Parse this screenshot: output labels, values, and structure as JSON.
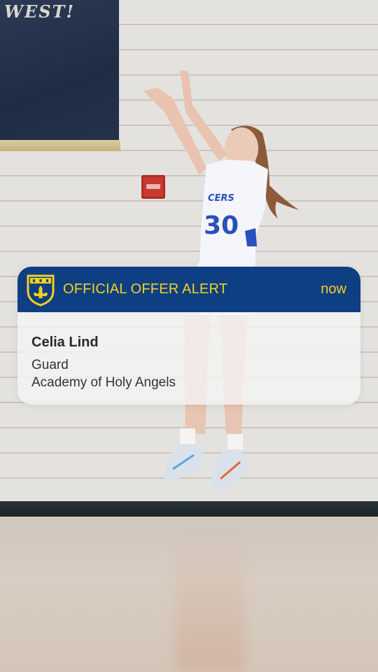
{
  "background": {
    "banner_text": "WEST!",
    "jersey_text": "CERS",
    "jersey_number": "30"
  },
  "notification": {
    "title": "OFFICIAL OFFER ALERT",
    "time": "now",
    "athlete_name": "Celia Lind",
    "position": "Guard",
    "school": "Academy of Holy Angels",
    "crest_icon": "fleur-de-lis-shield-icon"
  },
  "colors": {
    "header_bg": "#0d3f82",
    "accent_gold": "#f4d022",
    "body_bg": "#f5f5f5",
    "jersey_blue": "#2a4fbf"
  }
}
